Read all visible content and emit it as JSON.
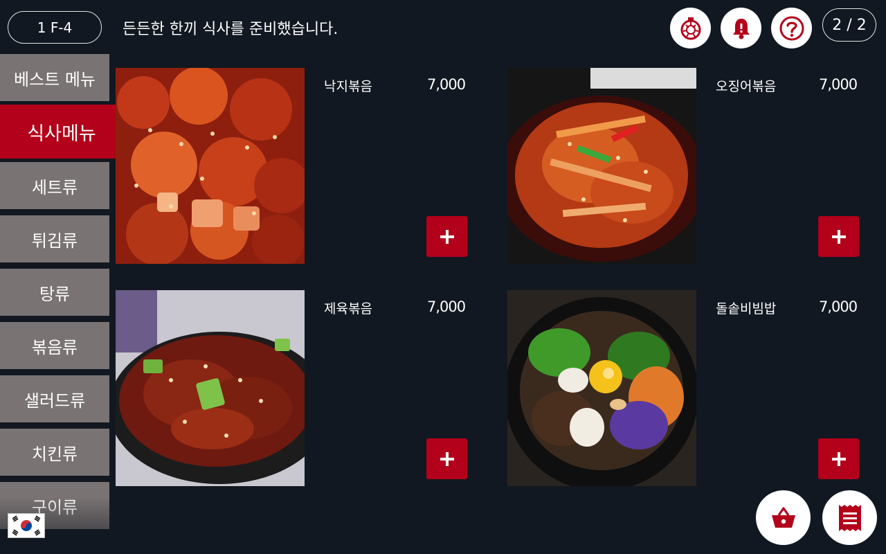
{
  "header": {
    "table_label": "1 F-4",
    "greeting": "든든한 한끼 식사를 준비했습니다.",
    "page_indicator": "2 / 2",
    "icons": [
      "timer-icon",
      "bell-icon",
      "help-icon"
    ]
  },
  "sidebar": {
    "items": [
      {
        "label": "베스트 메뉴"
      },
      {
        "label": "식사메뉴",
        "active": true
      },
      {
        "label": "세트류"
      },
      {
        "label": "튀김류"
      },
      {
        "label": "탕류"
      },
      {
        "label": "볶음류"
      },
      {
        "label": "샐러드류"
      },
      {
        "label": "치킨류"
      },
      {
        "label": "구이류"
      }
    ]
  },
  "menu": {
    "items": [
      {
        "name": "낙지볶음",
        "price": "7,000"
      },
      {
        "name": "오징어볶음",
        "price": "7,000"
      },
      {
        "name": "제육볶음",
        "price": "7,000"
      },
      {
        "name": "돌솥비빔밥",
        "price": "7,000"
      }
    ]
  },
  "colors": {
    "background": "#111821",
    "accent": "#b3001b",
    "category": "#7a7373"
  },
  "footer": {
    "icons": [
      "basket-icon",
      "receipt-icon",
      "korea-flag-icon"
    ]
  }
}
